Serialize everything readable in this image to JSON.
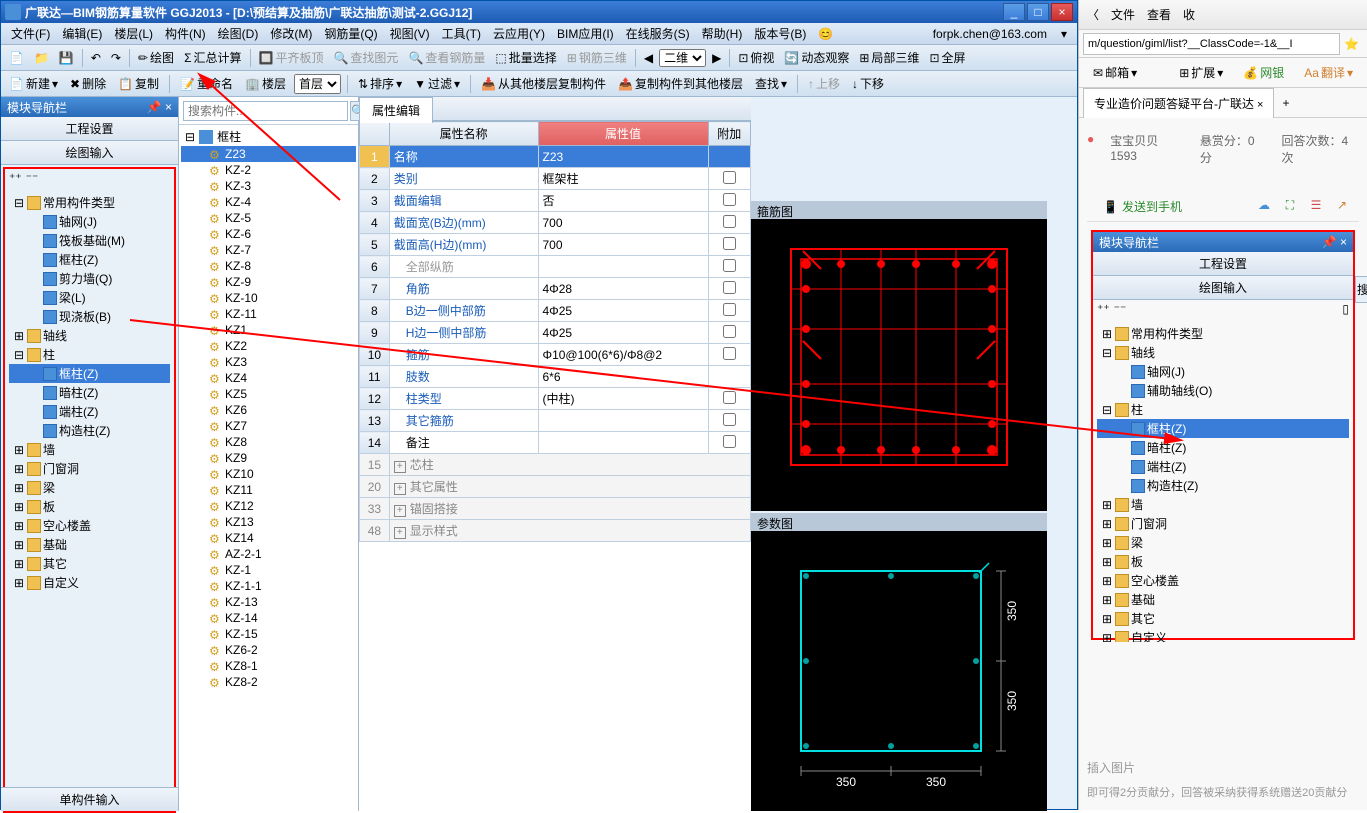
{
  "app": {
    "title": "广联达—BIM钢筋算量软件 GGJ2013 - [D:\\预结算及抽筋\\广联达抽筋\\测试-2.GGJ12]",
    "user_email": "forpk.chen@163.com"
  },
  "menubar": [
    "文件(F)",
    "编辑(E)",
    "楼层(L)",
    "构件(N)",
    "绘图(D)",
    "修改(M)",
    "钢筋量(Q)",
    "视图(V)",
    "工具(T)",
    "云应用(Y)",
    "BIM应用(I)",
    "在线服务(S)",
    "帮助(H)",
    "版本号(B)"
  ],
  "toolbar1": {
    "items": [
      "绘图",
      "汇总计算",
      "平齐板顶",
      "查找图元",
      "查看钢筋量",
      "批量选择",
      "钢筋三维",
      "二维",
      "俯视",
      "动态观察",
      "局部三维",
      "全屏"
    ]
  },
  "toolbar2": {
    "new": "新建",
    "delete": "删除",
    "copy": "复制",
    "rename": "重命名",
    "floor": "楼层",
    "floor_val": "首层",
    "sort": "排序",
    "filter": "过滤",
    "copy_from": "从其他楼层复制构件",
    "copy_to": "复制构件到其他楼层",
    "find": "查找",
    "up": "上移",
    "down": "下移"
  },
  "module_nav": {
    "title": "模块导航栏",
    "tab1": "工程设置",
    "tab2": "绘图输入",
    "footer": "单构件输入",
    "tree": [
      {
        "label": "常用构件类型",
        "level": 1,
        "icon": "folder",
        "expand": "-"
      },
      {
        "label": "轴网(J)",
        "level": 2,
        "icon": "grid"
      },
      {
        "label": "筏板基础(M)",
        "level": 2,
        "icon": "raft"
      },
      {
        "label": "框柱(Z)",
        "level": 2,
        "icon": "column"
      },
      {
        "label": "剪力墙(Q)",
        "level": 2,
        "icon": "wall"
      },
      {
        "label": "梁(L)",
        "level": 2,
        "icon": "beam"
      },
      {
        "label": "现浇板(B)",
        "level": 2,
        "icon": "slab"
      },
      {
        "label": "轴线",
        "level": 1,
        "icon": "folder",
        "expand": "+"
      },
      {
        "label": "柱",
        "level": 1,
        "icon": "folder",
        "expand": "-"
      },
      {
        "label": "框柱(Z)",
        "level": 2,
        "icon": "column",
        "selected": true
      },
      {
        "label": "暗柱(Z)",
        "level": 2,
        "icon": "column"
      },
      {
        "label": "端柱(Z)",
        "level": 2,
        "icon": "column"
      },
      {
        "label": "构造柱(Z)",
        "level": 2,
        "icon": "column"
      },
      {
        "label": "墙",
        "level": 1,
        "icon": "folder",
        "expand": "+"
      },
      {
        "label": "门窗洞",
        "level": 1,
        "icon": "folder",
        "expand": "+"
      },
      {
        "label": "梁",
        "level": 1,
        "icon": "folder",
        "expand": "+"
      },
      {
        "label": "板",
        "level": 1,
        "icon": "folder",
        "expand": "+"
      },
      {
        "label": "空心楼盖",
        "level": 1,
        "icon": "folder",
        "expand": "+"
      },
      {
        "label": "基础",
        "level": 1,
        "icon": "folder",
        "expand": "+"
      },
      {
        "label": "其它",
        "level": 1,
        "icon": "folder",
        "expand": "+"
      },
      {
        "label": "自定义",
        "level": 1,
        "icon": "folder",
        "expand": "+"
      }
    ]
  },
  "component_list": {
    "search_placeholder": "搜索构件...",
    "root": "框柱",
    "items": [
      "Z23",
      "KZ-2",
      "KZ-3",
      "KZ-4",
      "KZ-5",
      "KZ-6",
      "KZ-7",
      "KZ-8",
      "KZ-9",
      "KZ-10",
      "KZ-11",
      "KZ1",
      "KZ2",
      "KZ3",
      "KZ4",
      "KZ5",
      "KZ6",
      "KZ7",
      "KZ8",
      "KZ9",
      "KZ10",
      "KZ11",
      "KZ12",
      "KZ13",
      "KZ14",
      "AZ-2-1",
      "KZ-1",
      "KZ-1-1",
      "KZ-13",
      "KZ-14",
      "KZ-15",
      "KZ6-2",
      "KZ8-1",
      "KZ8-2"
    ],
    "selected": 0
  },
  "prop_editor": {
    "tab": "属性编辑",
    "headers": [
      "",
      "属性名称",
      "属性值",
      "附加"
    ],
    "rows": [
      {
        "num": "1",
        "name": "名称",
        "val": "Z23",
        "selected": true
      },
      {
        "num": "2",
        "name": "类别",
        "val": "框架柱",
        "check": false,
        "link": true
      },
      {
        "num": "3",
        "name": "截面编辑",
        "val": "否",
        "check": false,
        "link": true
      },
      {
        "num": "4",
        "name": "截面宽(B边)(mm)",
        "val": "700",
        "check": false,
        "link": true
      },
      {
        "num": "5",
        "name": "截面高(H边)(mm)",
        "val": "700",
        "check": false,
        "link": true
      },
      {
        "num": "6",
        "name": "全部纵筋",
        "val": "",
        "check": false,
        "gray": true,
        "indent": true
      },
      {
        "num": "7",
        "name": "角筋",
        "val": "4Φ28",
        "check": false,
        "link": true,
        "indent": true
      },
      {
        "num": "8",
        "name": "B边一侧中部筋",
        "val": "4Φ25",
        "check": false,
        "link": true,
        "indent": true
      },
      {
        "num": "9",
        "name": "H边一侧中部筋",
        "val": "4Φ25",
        "check": false,
        "link": true,
        "indent": true
      },
      {
        "num": "10",
        "name": "箍筋",
        "val": "Φ10@100(6*6)/Φ8@2",
        "check": false,
        "link": true,
        "indent": true
      },
      {
        "num": "11",
        "name": "肢数",
        "val": "6*6",
        "link": true,
        "indent": true
      },
      {
        "num": "12",
        "name": "柱类型",
        "val": "(中柱)",
        "check": false,
        "link": true,
        "indent": true
      },
      {
        "num": "13",
        "name": "其它箍筋",
        "val": "",
        "check": false,
        "link": true,
        "indent": true
      },
      {
        "num": "14",
        "name": "备注",
        "val": "",
        "check": false,
        "indent": true
      },
      {
        "num": "15",
        "name": "芯柱",
        "group": true,
        "expand": "+"
      },
      {
        "num": "20",
        "name": "其它属性",
        "group": true,
        "expand": "+"
      },
      {
        "num": "33",
        "name": "锚固搭接",
        "group": true,
        "expand": "+"
      },
      {
        "num": "48",
        "name": "显示样式",
        "group": true,
        "expand": "+"
      }
    ]
  },
  "draw1": {
    "title": "箍筋图"
  },
  "draw2": {
    "title": "参数图",
    "dim1": "350",
    "dim2": "350",
    "dim3": "350",
    "dim4": "350"
  },
  "browser": {
    "nav": [
      "文件",
      "查看",
      "收"
    ],
    "url": "m/question/giml/list?__ClassCode=-1&__I",
    "bookmarks": {
      "mail": "邮箱",
      "ext": "扩展",
      "bank": "网银",
      "trans": "翻译"
    },
    "tab": "专业造价问题答疑平台-广联达",
    "meta": {
      "user": "宝宝贝贝1593",
      "reward": "悬赏分：0分",
      "answers": "回答次数：4次"
    },
    "send": "发送到手机",
    "insert_pic": "插入图片",
    "reward_text": "即可得2分贡献分，回答被采纳获得系统赠送20贡献分"
  },
  "right_nav": {
    "title": "模块导航栏",
    "tab1": "工程设置",
    "tab2": "绘图输入",
    "tree": [
      {
        "label": "常用构件类型",
        "level": 1,
        "icon": "folder",
        "expand": "+"
      },
      {
        "label": "轴线",
        "level": 1,
        "icon": "folder",
        "expand": "-"
      },
      {
        "label": "轴网(J)",
        "level": 2,
        "icon": "grid"
      },
      {
        "label": "辅助轴线(O)",
        "level": 2,
        "icon": "grid"
      },
      {
        "label": "柱",
        "level": 1,
        "icon": "folder",
        "expand": "-"
      },
      {
        "label": "框柱(Z)",
        "level": 2,
        "icon": "column",
        "selected": true
      },
      {
        "label": "暗柱(Z)",
        "level": 2,
        "icon": "column"
      },
      {
        "label": "端柱(Z)",
        "level": 2,
        "icon": "column"
      },
      {
        "label": "构造柱(Z)",
        "level": 2,
        "icon": "column"
      },
      {
        "label": "墙",
        "level": 1,
        "icon": "folder",
        "expand": "+"
      },
      {
        "label": "门窗洞",
        "level": 1,
        "icon": "folder",
        "expand": "+"
      },
      {
        "label": "梁",
        "level": 1,
        "icon": "folder",
        "expand": "+"
      },
      {
        "label": "板",
        "level": 1,
        "icon": "folder",
        "expand": "+"
      },
      {
        "label": "空心楼盖",
        "level": 1,
        "icon": "folder",
        "expand": "+"
      },
      {
        "label": "基础",
        "level": 1,
        "icon": "folder",
        "expand": "+"
      },
      {
        "label": "其它",
        "level": 1,
        "icon": "folder",
        "expand": "+"
      },
      {
        "label": "自定义",
        "level": 1,
        "icon": "folder",
        "expand": "+"
      }
    ]
  }
}
